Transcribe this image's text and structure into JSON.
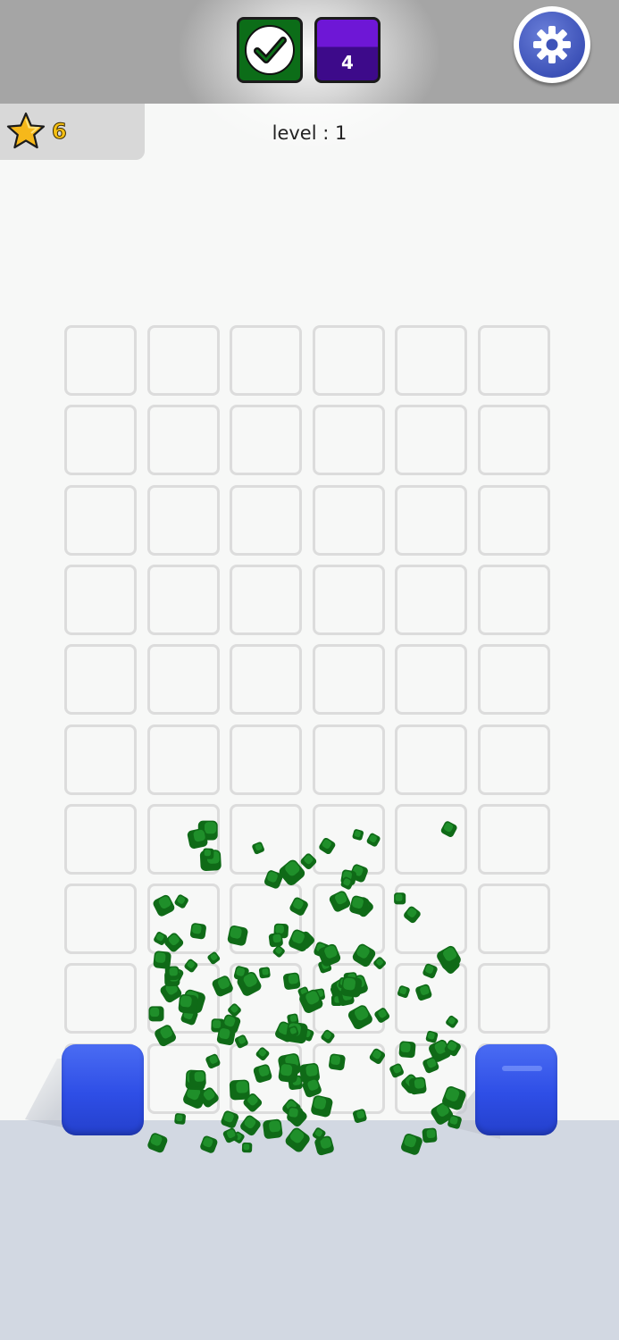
{
  "header": {
    "goals": [
      {
        "color": "#0c6d18",
        "completed": true,
        "icon": "checkmark-icon"
      },
      {
        "color": "#6e17d6",
        "count": "4",
        "completed": false
      }
    ],
    "settings_icon": "gear-icon"
  },
  "stars": {
    "icon": "star-icon",
    "count": "6"
  },
  "level": {
    "label": "level : 1"
  },
  "board": {
    "columns": 6,
    "rows": 10,
    "cell_state": "empty"
  },
  "blocks": {
    "color": "#3351e8",
    "count": 2
  },
  "pieces": {
    "color": "#137a1e",
    "count": 130
  }
}
